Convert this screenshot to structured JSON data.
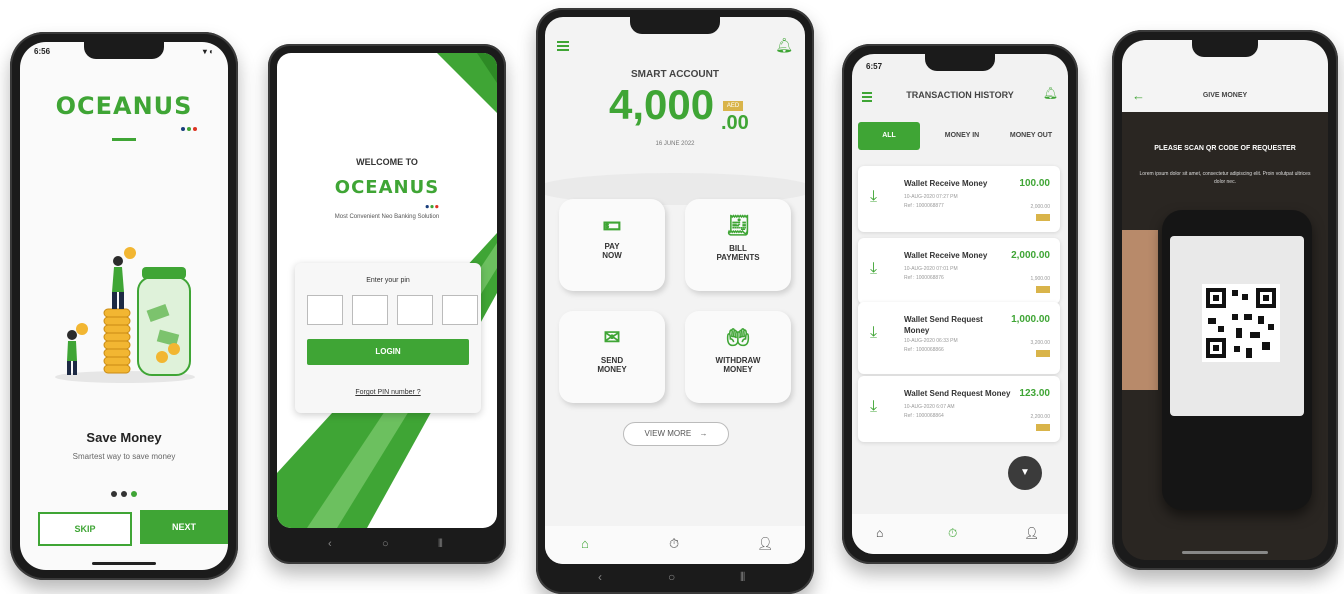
{
  "phone1": {
    "time": "6:56",
    "status_icons": "▾ ◐",
    "logo": "OCEANUS",
    "title": "Save Money",
    "subtitle": "Smartest way to save money",
    "skip": "SKIP",
    "next": "NEXT"
  },
  "phone2": {
    "welcome": "WELCOME TO",
    "logo": "OCEANUS",
    "tagline": "Most Convenient Neo Banking Solution",
    "pin_label": "Enter your pin",
    "login": "LOGIN",
    "forgot": "Forgot PIN number ?"
  },
  "phone3": {
    "account_title": "SMART ACCOUNT",
    "balance": "4,000",
    "cents": ".00",
    "currency": "AED",
    "date": "16 JUNE 2022",
    "tiles": [
      {
        "line1": "PAY",
        "line2": "NOW"
      },
      {
        "line1": "BILL",
        "line2": "PAYMENTS"
      },
      {
        "line1": "SEND",
        "line2": "MONEY"
      },
      {
        "line1": "WITHDRAW",
        "line2": "MONEY"
      }
    ],
    "view_more": "VIEW MORE",
    "arrow": "→"
  },
  "phone4": {
    "time": "6:57",
    "title": "TRANSACTION HISTORY",
    "tabs": [
      "ALL",
      "MONEY IN",
      "MONEY OUT"
    ],
    "transactions": [
      {
        "title": "Wallet Receive Money",
        "amount": "100.00",
        "date": "10-AUG-2020 07:27 PM",
        "ref": "Ref : 1000068877",
        "balance": "2,000.00"
      },
      {
        "title": "Wallet Receive Money",
        "amount": "2,000.00",
        "date": "10-AUG-2020 07:01 PM",
        "ref": "Ref : 1000068876",
        "balance": "1,900.00"
      },
      {
        "title": "Wallet Send Request Money",
        "amount": "1,000.00",
        "date": "10-AUG-2020 06:33 PM",
        "ref": "Ref : 1000068866",
        "balance": "3,200.00"
      },
      {
        "title": "Wallet Send Request Money",
        "amount": "123.00",
        "date": "10-AUG-2020 6:07 AM",
        "ref": "Ref : 1000068864",
        "balance": "2,200.00"
      }
    ]
  },
  "phone5": {
    "title": "GIVE MONEY",
    "scan_title": "PLEASE SCAN QR CODE OF REQUESTER",
    "scan_text": "Lorem ipsum dolor sit amet, consectetur adipiscing elit. Proin volutpat ultrices dolor nec."
  },
  "colors": {
    "accent": "#3fa535",
    "gold": "#d9b44a",
    "dark": "#1b1b1b"
  }
}
